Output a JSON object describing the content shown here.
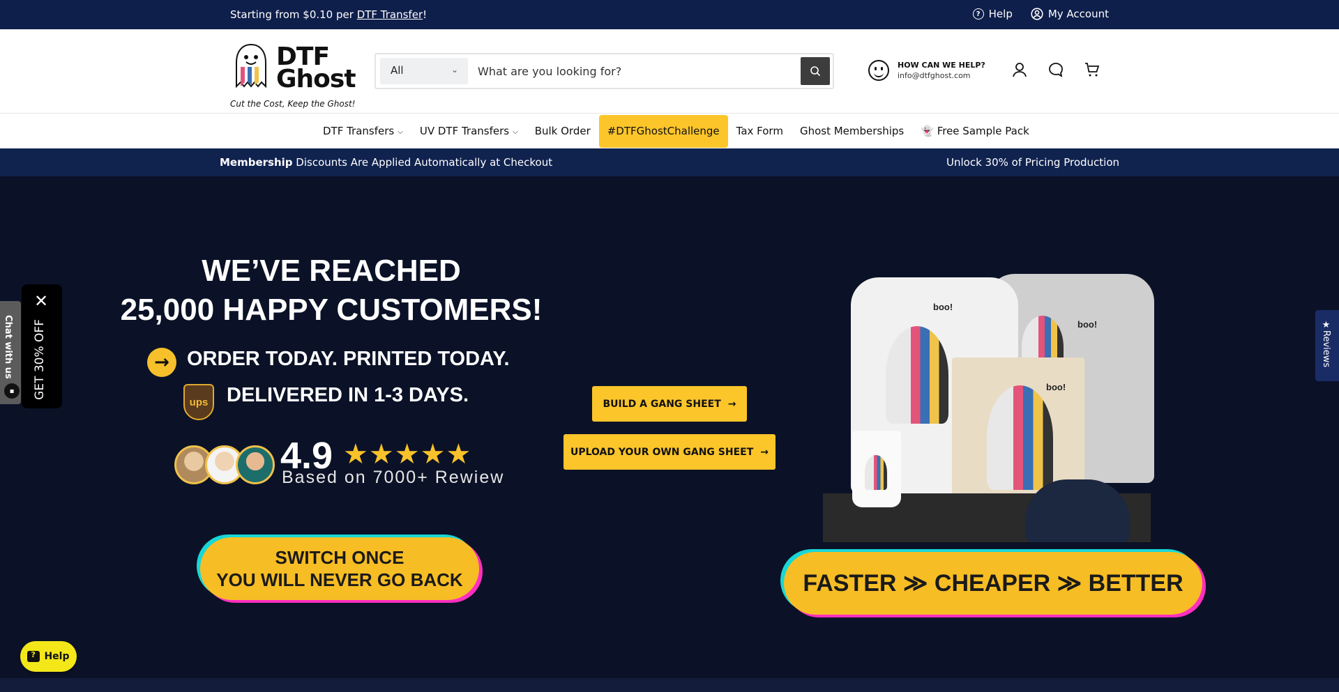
{
  "topbar": {
    "promo_prefix": "Starting from $0.10 per ",
    "promo_link": "DTF Transfer",
    "promo_suffix": "!",
    "help_label": "Help",
    "account_label": "My Account"
  },
  "header": {
    "brand_line1": "DTF",
    "brand_line2": "Ghost",
    "tagline": "Cut the Cost, Keep the Ghost!",
    "search": {
      "category": "All",
      "placeholder": "What are you looking for?"
    },
    "contact": {
      "title": "HOW CAN WE HELP?",
      "email": "info@dtfghost.com"
    }
  },
  "nav": {
    "items": [
      {
        "label": "DTF Transfers",
        "dropdown": true
      },
      {
        "label": "UV DTF Transfers",
        "dropdown": true
      },
      {
        "label": "Bulk Order"
      },
      {
        "label": "#DTFGhostChallenge",
        "highlight": true
      },
      {
        "label": "Tax Form"
      },
      {
        "label": "Ghost Memberships"
      },
      {
        "label": "👻 Free Sample Pack"
      }
    ]
  },
  "membership": {
    "bold": "Membership",
    "text": " Discounts Are Applied Automatically at Checkout",
    "right": "Unlock 30% of Pricing Production"
  },
  "hero": {
    "title_line1": "WE’VE REACHED",
    "title_line2": "25,000 HAPPY CUSTOMERS!",
    "line1": "ORDER TODAY. PRINTED TODAY.",
    "line2": "DELIVERED IN 1-3 DAYS.",
    "ups_badge": "ups",
    "rating": "4.9",
    "stars": "★★★★★",
    "based_on": "Based on 7000+ Rewiew",
    "switch_line1": "SWITCH ONCE",
    "switch_line2": "YOU WILL NEVER GO BACK",
    "cta_build": "BUILD A GANG SHEET",
    "cta_upload": "UPLOAD YOUR OWN GANG SHEET",
    "faster_pill": "FASTER ≫ CHEAPER ≫ BETTER",
    "boo_text": "boo!"
  },
  "widgets": {
    "chat_tab": "Chat with us",
    "get_off": "GET 30% OFF",
    "close_glyph": "✕",
    "reviews_tab": "★Reviews",
    "help_button": "Help"
  },
  "colors": {
    "topbar": "#0f1f4b",
    "accent_yellow": "#fcc52a",
    "hero_bg": "#0b1227",
    "membership_bar": "#10224e"
  }
}
